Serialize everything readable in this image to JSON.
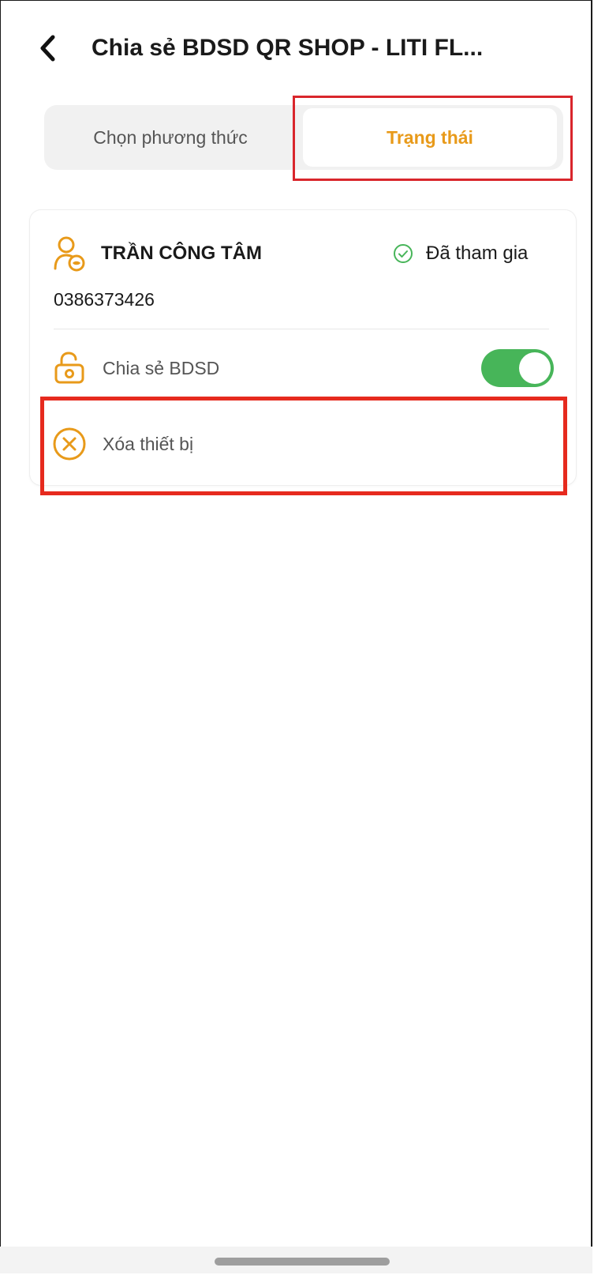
{
  "header": {
    "back_icon": "chevron-left-icon",
    "title": "Chia sẻ BDSD QR SHOP - LITI FL..."
  },
  "tabs": [
    {
      "label": "Chọn phương thức",
      "active": false
    },
    {
      "label": "Trạng thái",
      "active": true
    }
  ],
  "member": {
    "name": "TRẦN CÔNG TÂM",
    "phone": "0386373426",
    "status": "Đã tham gia",
    "status_icon": "check-circle-icon",
    "user_icon": "user-icon"
  },
  "options": {
    "share": {
      "label": "Chia sẻ BDSD",
      "icon": "unlock-icon",
      "enabled": true
    },
    "delete": {
      "label": "Xóa thiết bị",
      "icon": "close-circle-icon"
    }
  },
  "colors": {
    "accent": "#e89a1a",
    "toggle_on": "#47b559",
    "highlight": "#e62a1e",
    "status_check": "#47b559"
  }
}
